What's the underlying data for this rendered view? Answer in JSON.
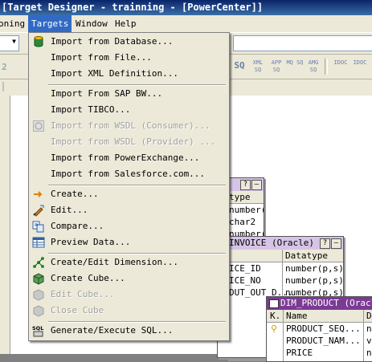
{
  "window": {
    "title": "[Target Designer - trainning - [PowerCenter]]"
  },
  "menubar": {
    "items": [
      {
        "label": "oning"
      },
      {
        "label": "Targets"
      },
      {
        "label": "Window"
      },
      {
        "label": "Help"
      }
    ]
  },
  "toolbar": {
    "buttons": [
      {
        "icon": "sq-icon",
        "label": "SQ"
      },
      {
        "icon": "xml-sq-icon",
        "label": "XML SQ"
      },
      {
        "icon": "app-sq-icon",
        "label": "APP SQ"
      },
      {
        "icon": "mq-sq-icon",
        "label": "MQ SQ"
      },
      {
        "icon": "amg-sq-icon",
        "label": "AMG SQ"
      },
      {
        "icon": "idoc-icon",
        "label": "IDOC"
      },
      {
        "icon": "idoc-icon-2",
        "label": "IDOC"
      }
    ],
    "left_fragment": "2"
  },
  "targets_menu": {
    "items": [
      {
        "label": "Import from Database...",
        "icon": "database-icon",
        "enabled": true
      },
      {
        "label": "Import from File...",
        "enabled": true
      },
      {
        "label": "Import XML Definition...",
        "enabled": true
      },
      {
        "label": "Import From SAP BW...",
        "enabled": true
      },
      {
        "label": "Import TIBCO...",
        "enabled": true
      },
      {
        "label": "Import from WSDL (Consumer)...",
        "icon": "wsdl-icon",
        "enabled": false
      },
      {
        "label": "Import from WSDL (Provider) ...",
        "enabled": false
      },
      {
        "label": "Import from PowerExchange...",
        "enabled": true
      },
      {
        "label": "Import from Salesforce.com...",
        "enabled": true
      },
      {
        "label": "Create...",
        "icon": "create-arrow-icon",
        "enabled": true
      },
      {
        "label": "Edit...",
        "icon": "edit-icon",
        "enabled": true
      },
      {
        "label": "Compare...",
        "icon": "compare-icon",
        "enabled": true
      },
      {
        "label": "Preview Data...",
        "icon": "preview-data-icon",
        "enabled": true
      },
      {
        "label": "Create/Edit Dimension...",
        "icon": "dimension-icon",
        "enabled": true
      },
      {
        "label": "Create Cube...",
        "icon": "cube-icon",
        "enabled": true
      },
      {
        "label": "Edit Cube...",
        "icon": "edit-cube-icon",
        "enabled": false
      },
      {
        "label": "Close Cube",
        "icon": "close-cube-icon",
        "enabled": false
      },
      {
        "label": "Generate/Execute SQL...",
        "icon": "sql-icon",
        "enabled": true
      }
    ]
  },
  "tables": {
    "first": {
      "header": "type",
      "rows": [
        "number(p,s)",
        "char2",
        "number(p,s)"
      ]
    },
    "invoice": {
      "title": "INVOICE (Oracle)",
      "col2": "Datatype",
      "rows": [
        {
          "name": "ICE_ID",
          "type": "number(p,s)"
        },
        {
          "name": "ICE_NO",
          "type": "number(p,s)"
        },
        {
          "name": "DUT_OUT_D...",
          "type": "number(p,s)"
        }
      ]
    },
    "dim_product": {
      "title": "DIM_PRODUCT (Oracle)",
      "col_k": "K.",
      "col_name": "Name",
      "col_d": "D",
      "rows": [
        {
          "name": "PRODUCT_SEQ...",
          "d": "n",
          "key": true
        },
        {
          "name": "PRODUCT_NAM...",
          "d": "v",
          "key": false
        },
        {
          "name": "PRICE",
          "d": "n",
          "key": false
        }
      ]
    },
    "controls": {
      "help": "?",
      "minimize": "–"
    }
  }
}
